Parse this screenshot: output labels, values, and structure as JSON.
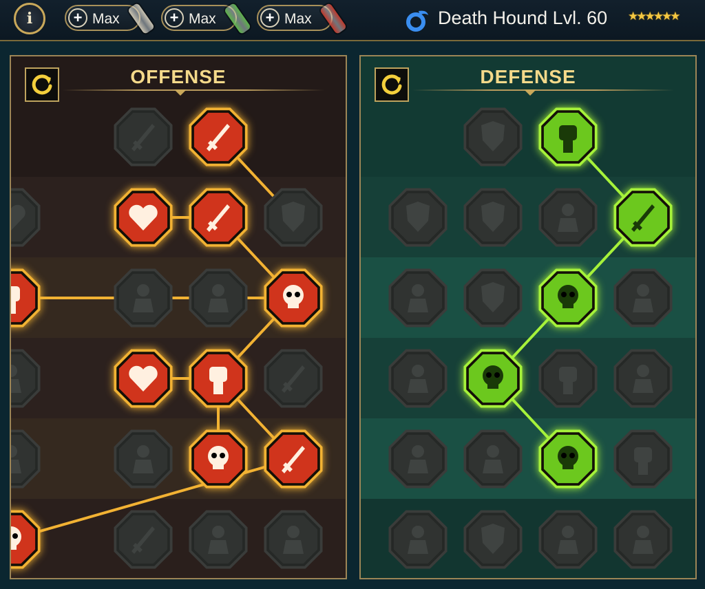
{
  "header": {
    "info_label": "i",
    "resource_buttons": [
      {
        "label": "Max",
        "scroll_color": "#c9c2b0"
      },
      {
        "label": "Max",
        "scroll_color": "#5db34a"
      },
      {
        "label": "Max",
        "scroll_color": "#c0392b"
      }
    ],
    "hero_name": "Death Hound Lvl. 60",
    "stars": "★★★★★★"
  },
  "offense": {
    "title": "OFFENSE",
    "accent": "#f2b233",
    "active_fill": "#d0341c",
    "lines": [
      [
        2,
        1,
        3,
        2
      ],
      [
        2,
        2,
        3,
        3
      ],
      [
        1,
        2,
        2,
        2
      ],
      [
        3,
        3,
        4,
        3
      ],
      [
        3,
        3,
        2,
        4
      ],
      [
        1,
        4,
        2,
        4
      ],
      [
        2,
        4,
        2,
        5
      ],
      [
        2,
        4,
        3,
        5
      ],
      [
        3,
        5,
        4,
        6
      ]
    ],
    "nodes": [
      {
        "col": 1,
        "row": 1,
        "icon": "crossed-swords-icon",
        "active": false
      },
      {
        "col": 2,
        "row": 1,
        "icon": "blade-slash-icon",
        "active": true
      },
      {
        "col": 1,
        "row": 2,
        "icon": "horned-heart-demon-icon",
        "active": true
      },
      {
        "col": 2,
        "row": 2,
        "icon": "piercing-spear-icon",
        "active": true
      },
      {
        "col": 3,
        "row": 2,
        "icon": "shield-arrow-icon",
        "active": false
      },
      {
        "col": 4,
        "row": 2,
        "icon": "bleeding-heart-icon",
        "active": false
      },
      {
        "col": 1,
        "row": 3,
        "icon": "arrow-pierced-warrior-icon",
        "active": false
      },
      {
        "col": 2,
        "row": 3,
        "icon": "fanged-maw-icon",
        "active": false
      },
      {
        "col": 3,
        "row": 3,
        "icon": "skull-slash-icon",
        "active": true
      },
      {
        "col": 4,
        "row": 3,
        "icon": "fist-scythe-icon",
        "active": true
      },
      {
        "col": 1,
        "row": 4,
        "icon": "dagger-heart-icon",
        "active": true
      },
      {
        "col": 2,
        "row": 4,
        "icon": "fist-blade-icon",
        "active": true
      },
      {
        "col": 3,
        "row": 4,
        "icon": "axe-strike-icon",
        "active": false
      },
      {
        "col": 4,
        "row": 4,
        "icon": "lightning-chain-icon",
        "active": false
      },
      {
        "col": 1,
        "row": 5,
        "icon": "arrow-volley-icon",
        "active": false
      },
      {
        "col": 2,
        "row": 5,
        "icon": "triple-skull-icon",
        "active": true
      },
      {
        "col": 3,
        "row": 5,
        "icon": "sword-crescent-icon",
        "active": true
      },
      {
        "col": 4,
        "row": 5,
        "icon": "muscle-warrior-icon",
        "active": false
      },
      {
        "col": 1,
        "row": 6,
        "icon": "sparkle-sword-icon",
        "active": false
      },
      {
        "col": 2,
        "row": 6,
        "icon": "helmet-icon",
        "active": false
      },
      {
        "col": 3,
        "row": 6,
        "icon": "horned-demon-icon",
        "active": false
      },
      {
        "col": 4,
        "row": 6,
        "icon": "spartan-skull-icon",
        "active": true
      }
    ]
  },
  "defense": {
    "title": "DEFENSE",
    "accent": "#a6f23a",
    "active_fill": "#6cc81e",
    "lines": [
      [
        2,
        1,
        3,
        2
      ],
      [
        3,
        2,
        2,
        3
      ],
      [
        2,
        3,
        1,
        4
      ],
      [
        1,
        4,
        2,
        5
      ]
    ],
    "nodes": [
      {
        "col": 1,
        "row": 1,
        "icon": "broken-armor-icon",
        "active": false
      },
      {
        "col": 2,
        "row": 1,
        "icon": "raised-fist-icon",
        "active": true
      },
      {
        "col": 0,
        "row": 2,
        "icon": "shield-chevron-icon",
        "active": false
      },
      {
        "col": 1,
        "row": 2,
        "icon": "armor-vest-icon",
        "active": false
      },
      {
        "col": 2,
        "row": 2,
        "icon": "golem-icon",
        "active": false
      },
      {
        "col": 3,
        "row": 2,
        "icon": "crossed-blades-icon",
        "active": true
      },
      {
        "col": 0,
        "row": 3,
        "icon": "hero-kick-icon",
        "active": false
      },
      {
        "col": 1,
        "row": 3,
        "icon": "knight-shield-icon",
        "active": false
      },
      {
        "col": 2,
        "row": 3,
        "icon": "skull-heart-icon",
        "active": true
      },
      {
        "col": 3,
        "row": 3,
        "icon": "hooded-figure-icon",
        "active": false
      },
      {
        "col": 0,
        "row": 4,
        "icon": "crowd-icon",
        "active": false
      },
      {
        "col": 1,
        "row": 4,
        "icon": "hourglass-skull-icon",
        "active": true
      },
      {
        "col": 2,
        "row": 4,
        "icon": "open-palm-icon",
        "active": false
      },
      {
        "col": 3,
        "row": 4,
        "icon": "bull-head-icon",
        "active": false
      },
      {
        "col": 0,
        "row": 5,
        "icon": "dashing-runner-icon",
        "active": false
      },
      {
        "col": 1,
        "row": 5,
        "icon": "blood-drops-icon",
        "active": false
      },
      {
        "col": 2,
        "row": 5,
        "icon": "radiant-skull-icon",
        "active": true
      },
      {
        "col": 3,
        "row": 5,
        "icon": "grasping-hand-icon",
        "active": false
      },
      {
        "col": 0,
        "row": 6,
        "icon": "fire-demon-icon",
        "active": false
      },
      {
        "col": 1,
        "row": 6,
        "icon": "winged-shield-icon",
        "active": false
      },
      {
        "col": 2,
        "row": 6,
        "icon": "bald-brute-icon",
        "active": false
      },
      {
        "col": 3,
        "row": 6,
        "icon": "strongman-icon",
        "active": false
      }
    ]
  }
}
